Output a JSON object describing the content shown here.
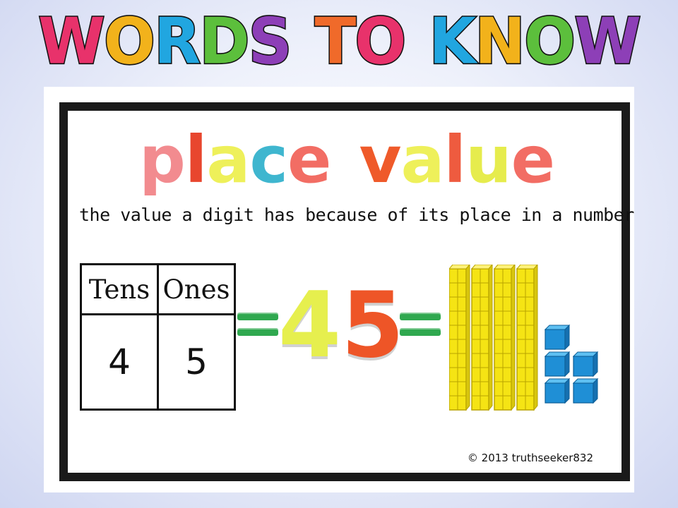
{
  "banner": {
    "words": [
      "WORDS",
      "TO",
      "KNOW"
    ],
    "letter_colors": [
      "#e8326b",
      "#f2b21b",
      "#21a6e0",
      "#5cbf3c",
      "#8d3fb7",
      "#f06a2a",
      "#e8326b",
      "#21a6e0",
      "#f2b21b",
      "#5cbf3c",
      "#8d3fb7"
    ]
  },
  "card": {
    "title": "place value",
    "title_colors": [
      "#f28b8f",
      "#e8462e",
      "#eef05a",
      "#3fb6cf",
      "#f26d64",
      "#ef5a2a",
      "#eef05a",
      "#ee5b3f",
      "#e6ec4d",
      "#f26d64"
    ],
    "definition": "the value a digit has because of its place in a number",
    "table": {
      "headers": [
        "Tens",
        "Ones"
      ],
      "values": [
        "4",
        "5"
      ]
    },
    "number": {
      "digits": [
        "4",
        "5"
      ],
      "digit_colors": [
        "#e6ef4e",
        "#ee5527"
      ]
    },
    "blocks": {
      "tens_rods": 4,
      "ones_cubes": 5,
      "rod_color": "#f5e414",
      "cube_color": "#1f8fd6"
    },
    "copyright": "© 2013 truthseeker832"
  }
}
